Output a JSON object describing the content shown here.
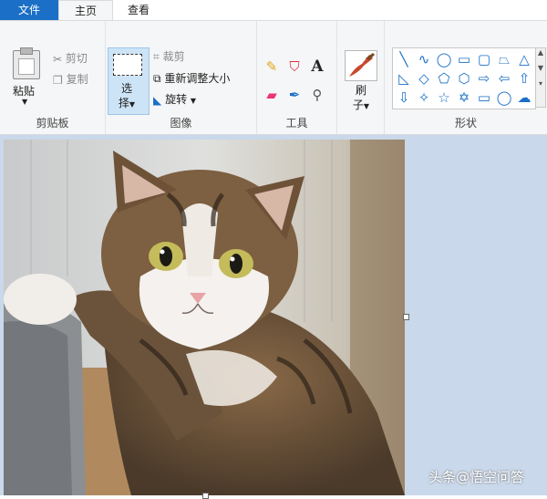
{
  "tabs": {
    "file": "文件",
    "home": "主页",
    "view": "查看"
  },
  "clipboard": {
    "paste": "粘贴",
    "cut": "剪切",
    "copy": "复制",
    "group": "剪贴板"
  },
  "image": {
    "select_line1": "选",
    "select_line2": "择",
    "crop": "裁剪",
    "resize": "重新调整大小",
    "rotate": "旋转",
    "group": "图像"
  },
  "tools": {
    "group": "工具"
  },
  "brush": {
    "line1": "刷",
    "line2": "子"
  },
  "shapes": {
    "group": "形状"
  },
  "watermark": "头条@悟空问答",
  "colors": {
    "accent": "#1b6fc7",
    "ribbon": "#f5f6f7",
    "workspace": "#c9d8ea"
  }
}
